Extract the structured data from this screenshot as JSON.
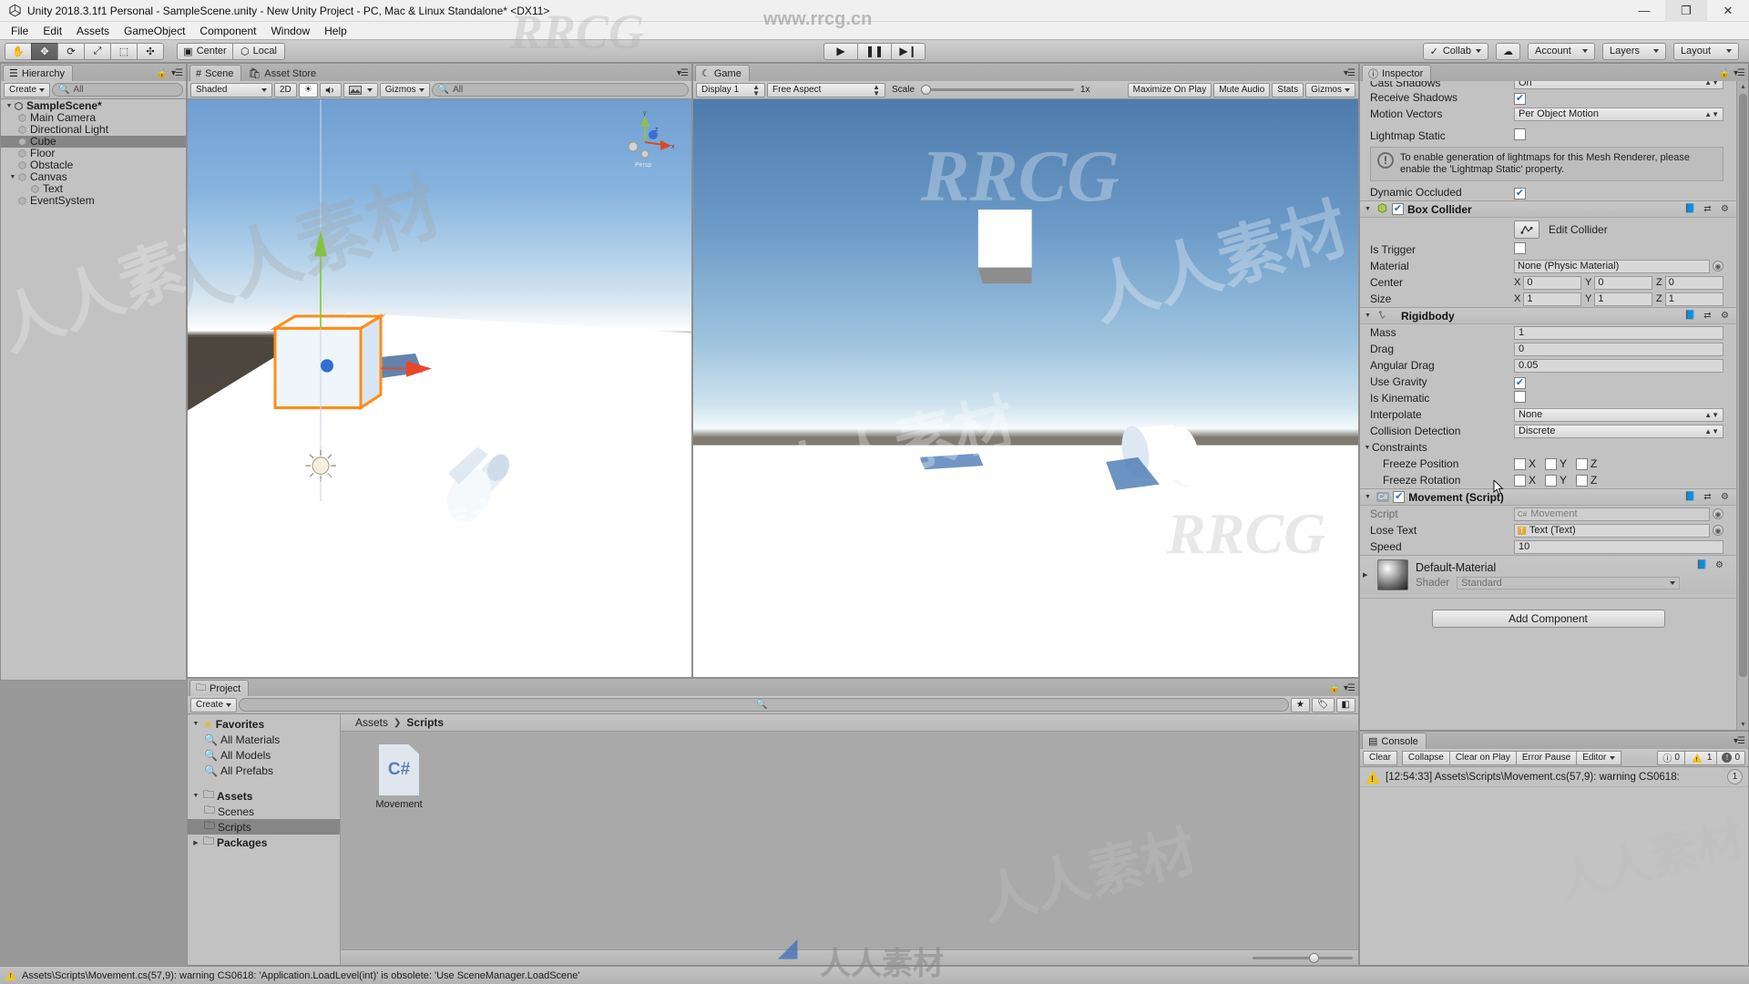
{
  "window": {
    "title": "Unity 2018.3.1f1 Personal - SampleScene.unity - New Unity Project - PC, Mac & Linux Standalone* <DX11>",
    "minimize": "—",
    "maximize": "❐",
    "close": "✕"
  },
  "menubar": {
    "items": [
      "File",
      "Edit",
      "Assets",
      "GameObject",
      "Component",
      "Window",
      "Help"
    ]
  },
  "toolbar": {
    "tools": [
      {
        "name": "hand-tool",
        "glyph": "✋",
        "active": false
      },
      {
        "name": "move-tool",
        "glyph": "✥",
        "active": true
      },
      {
        "name": "rotate-tool",
        "glyph": "⟳",
        "active": false
      },
      {
        "name": "scale-tool",
        "glyph": "⤢",
        "active": false
      },
      {
        "name": "rect-tool",
        "glyph": "⬚",
        "active": false
      },
      {
        "name": "transform-tool",
        "glyph": "✣",
        "active": false
      }
    ],
    "pivot_mode": "Center",
    "pivot_rotation": "Local",
    "play": "▶",
    "pause": "❚❚",
    "step": "▶❙",
    "collab": "Collab",
    "cloud": "☁",
    "account": "Account",
    "layers": "Layers",
    "layout": "Layout"
  },
  "hierarchy": {
    "tab": "Hierarchy",
    "create": "Create",
    "search_placeholder": "All",
    "items": [
      {
        "label": "SampleScene*",
        "depth": 0,
        "type": "scene",
        "expanded": true,
        "selected": false,
        "bold": true
      },
      {
        "label": "Main Camera",
        "depth": 1,
        "type": "object",
        "expanded": null,
        "selected": false,
        "bold": false
      },
      {
        "label": "Directional Light",
        "depth": 1,
        "type": "object",
        "expanded": null,
        "selected": false,
        "bold": false
      },
      {
        "label": "Cube",
        "depth": 1,
        "type": "object",
        "expanded": null,
        "selected": true,
        "bold": false
      },
      {
        "label": "Floor",
        "depth": 1,
        "type": "object",
        "expanded": null,
        "selected": false,
        "bold": false
      },
      {
        "label": "Obstacle",
        "depth": 1,
        "type": "object",
        "expanded": null,
        "selected": false,
        "bold": false
      },
      {
        "label": "Canvas",
        "depth": 1,
        "type": "object",
        "expanded": true,
        "selected": false,
        "bold": false
      },
      {
        "label": "Text",
        "depth": 2,
        "type": "object",
        "expanded": null,
        "selected": false,
        "bold": false
      },
      {
        "label": "EventSystem",
        "depth": 1,
        "type": "object",
        "expanded": null,
        "selected": false,
        "bold": false
      }
    ]
  },
  "scene": {
    "tabs": [
      {
        "label": "Scene",
        "active": true
      },
      {
        "label": "Asset Store",
        "active": false
      }
    ],
    "draw_mode": "Shaded",
    "mode_2d": "2D",
    "lighting_icon": "☀",
    "audio_icon": "◀))",
    "fx_icon": "🖼",
    "gizmos": "Gizmos",
    "search_placeholder": "All",
    "gizmo_axis_labels": {
      "y": "y",
      "x": "x",
      "z": "z",
      "persp": "Persp"
    }
  },
  "game": {
    "tab": "Game",
    "display": "Display 1",
    "aspect": "Free Aspect",
    "scale_label": "Scale",
    "scale_value": "1x",
    "maximize_on_play": "Maximize On Play",
    "mute_audio": "Mute Audio",
    "stats": "Stats",
    "gizmos": "Gizmos"
  },
  "inspector": {
    "tab": "Inspector",
    "mesh_renderer_tail": [
      {
        "label": "Cast Shadows",
        "type": "dropdown",
        "value": "On",
        "clipped": true
      },
      {
        "label": "Receive Shadows",
        "type": "checkbox",
        "value": true
      },
      {
        "label": "Motion Vectors",
        "type": "dropdown",
        "value": "Per Object Motion"
      },
      {
        "label": "Lightmap Static",
        "type": "checkbox",
        "value": false
      }
    ],
    "lightmap_help": "To enable generation of lightmaps for this Mesh Renderer, please enable the 'Lightmap Static' property.",
    "dynamic_occluded": {
      "label": "Dynamic Occluded",
      "value": true
    },
    "box_collider": {
      "title": "Box Collider",
      "enabled": true,
      "edit_collider": "Edit Collider",
      "rows": [
        {
          "label": "Is Trigger",
          "type": "checkbox",
          "value": false
        },
        {
          "label": "Material",
          "type": "object",
          "value": "None (Physic Material)"
        }
      ],
      "center": {
        "label": "Center",
        "x": "0",
        "y": "0",
        "z": "0"
      },
      "size": {
        "label": "Size",
        "x": "1",
        "y": "1",
        "z": "1"
      }
    },
    "rigidbody": {
      "title": "Rigidbody",
      "rows": [
        {
          "label": "Mass",
          "type": "text",
          "value": "1"
        },
        {
          "label": "Drag",
          "type": "text",
          "value": "0"
        },
        {
          "label": "Angular Drag",
          "type": "text",
          "value": "0.05"
        },
        {
          "label": "Use Gravity",
          "type": "checkbox",
          "value": true
        },
        {
          "label": "Is Kinematic",
          "type": "checkbox",
          "value": false
        },
        {
          "label": "Interpolate",
          "type": "dropdown",
          "value": "None"
        },
        {
          "label": "Collision Detection",
          "type": "dropdown",
          "value": "Discrete"
        }
      ],
      "constraints_label": "Constraints",
      "freeze_position": {
        "label": "Freeze Position",
        "x": false,
        "y": false,
        "z": false
      },
      "freeze_rotation": {
        "label": "Freeze Rotation",
        "x": false,
        "y": false,
        "z": false
      },
      "axis_labels": [
        "X",
        "Y",
        "Z"
      ]
    },
    "movement_script": {
      "title": "Movement (Script)",
      "enabled": true,
      "rows": [
        {
          "label": "Script",
          "type": "object-dim",
          "value": "Movement"
        },
        {
          "label": "Lose Text",
          "type": "object",
          "value": "Text (Text)"
        },
        {
          "label": "Speed",
          "type": "text",
          "value": "10"
        }
      ]
    },
    "material": {
      "name": "Default-Material",
      "shader_label": "Shader",
      "shader_value": "Standard"
    },
    "add_component": "Add Component"
  },
  "project": {
    "tab": "Project",
    "create": "Create",
    "search_placeholder": "",
    "tree": [
      {
        "label": "Favorites",
        "depth": 0,
        "icon": "star",
        "expanded": true,
        "bold": true,
        "selected": false
      },
      {
        "label": "All Materials",
        "depth": 1,
        "icon": "search",
        "expanded": null,
        "bold": false,
        "selected": false
      },
      {
        "label": "All Models",
        "depth": 1,
        "icon": "search",
        "expanded": null,
        "bold": false,
        "selected": false
      },
      {
        "label": "All Prefabs",
        "depth": 1,
        "icon": "search",
        "expanded": null,
        "bold": false,
        "selected": false
      },
      {
        "label": "",
        "depth": 0,
        "icon": "spacer",
        "expanded": null,
        "bold": false,
        "selected": false
      },
      {
        "label": "Assets",
        "depth": 0,
        "icon": "folder",
        "expanded": true,
        "bold": true,
        "selected": false
      },
      {
        "label": "Scenes",
        "depth": 1,
        "icon": "folder",
        "expanded": null,
        "bold": false,
        "selected": false
      },
      {
        "label": "Scripts",
        "depth": 1,
        "icon": "folder",
        "expanded": null,
        "bold": false,
        "selected": true
      },
      {
        "label": "Packages",
        "depth": 0,
        "icon": "folder",
        "expanded": false,
        "bold": true,
        "selected": false
      }
    ],
    "breadcrumb": {
      "root": "Assets",
      "sep": "❯",
      "current": "Scripts"
    },
    "assets": [
      {
        "label": "Movement",
        "icon": "C#"
      }
    ]
  },
  "console": {
    "tab": "Console",
    "buttons": [
      "Clear",
      "Collapse",
      "Clear on Play",
      "Error Pause",
      "Editor"
    ],
    "counts": [
      {
        "icon": "info",
        "value": "0"
      },
      {
        "icon": "warning",
        "value": "1"
      },
      {
        "icon": "error",
        "value": "0"
      }
    ],
    "entries": [
      {
        "severity": "warning",
        "text": "[12:54:33] Assets\\Scripts\\Movement.cs(57,9): warning CS0618:",
        "badge": "1"
      }
    ]
  },
  "statusbar": {
    "message": "Assets\\Scripts\\Movement.cs(57,9): warning CS0618: 'Application.LoadLevel(int)' is obsolete: 'Use SceneManager.LoadScene'"
  },
  "watermarks": {
    "site": "www.rrcg.cn",
    "latin": "RRCG",
    "cjk": "人人素材"
  },
  "colors": {
    "panel_bg": "#c2c2c2",
    "chrome": "#b8b8b8",
    "selection": "#868686",
    "accent_blue": "#2e6fb8",
    "warning": "#f0c419",
    "selected_outline": "#ff8c1a"
  }
}
